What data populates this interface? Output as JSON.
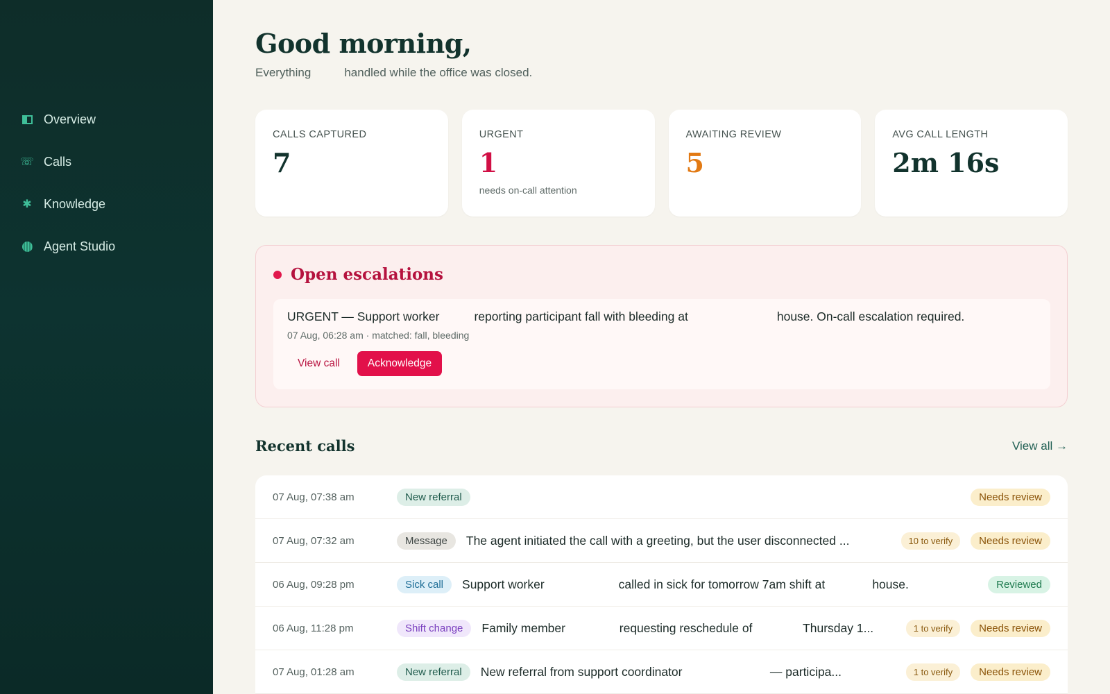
{
  "sidebar": {
    "items": [
      {
        "label": "Overview",
        "icon": "panel-icon"
      },
      {
        "label": "Calls",
        "icon": "phone-icon"
      },
      {
        "label": "Knowledge",
        "icon": "asterisk-icon"
      },
      {
        "label": "Agent Studio",
        "icon": "globe-icon"
      }
    ]
  },
  "header": {
    "greeting": "Good morning,",
    "sub_before": "Everything",
    "sub_after": "handled while the office was closed."
  },
  "stats": [
    {
      "label": "CALLS CAPTURED",
      "value": "7",
      "note": ""
    },
    {
      "label": "URGENT",
      "value": "1",
      "note": "needs on-call attention"
    },
    {
      "label": "AWAITING REVIEW",
      "value": "5",
      "note": ""
    },
    {
      "label": "AVG CALL LENGTH",
      "value": "2m 16s",
      "note": ""
    }
  ],
  "escalations": {
    "title": "Open escalations",
    "item": {
      "part1": "URGENT — Support worker",
      "part2": "reporting participant fall with bleeding at",
      "part3": "house. On-call escalation required.",
      "meta": "07 Aug, 06:28 am · matched: fall, bleeding",
      "view_label": "View call",
      "ack_label": "Acknowledge"
    }
  },
  "recent": {
    "title": "Recent calls",
    "view_all": "View all →",
    "rows": [
      {
        "time": "07 Aug, 07:38 am",
        "tag": "New referral",
        "summary": "",
        "verify": "",
        "status": "Needs review"
      },
      {
        "time": "07 Aug, 07:32 am",
        "tag": "Message",
        "summary": "The agent initiated the call with a greeting, but the user disconnected ...",
        "verify": "10 to verify",
        "status": "Needs review"
      },
      {
        "time": "06 Aug, 09:28 pm",
        "tag": "Sick call",
        "summary": "Support worker                      called in sick for tomorrow 7am shift at              house.",
        "verify": "",
        "status": "Reviewed"
      },
      {
        "time": "06 Aug, 11:28 pm",
        "tag": "Shift change",
        "summary": "Family member                requesting reschedule of               Thursday 1...",
        "verify": "1 to verify",
        "status": "Needs review"
      },
      {
        "time": "07 Aug, 01:28 am",
        "tag": "New referral",
        "summary": "New referral from support coordinator                          — participa...",
        "verify": "1 to verify",
        "status": "Needs review"
      }
    ]
  },
  "colors": {
    "sidebar_bg": "#0d3330",
    "accent_green": "#3fbf99",
    "urgent_red": "#d10f45",
    "review_orange": "#e27a14",
    "page_bg": "#f6f4ee"
  }
}
